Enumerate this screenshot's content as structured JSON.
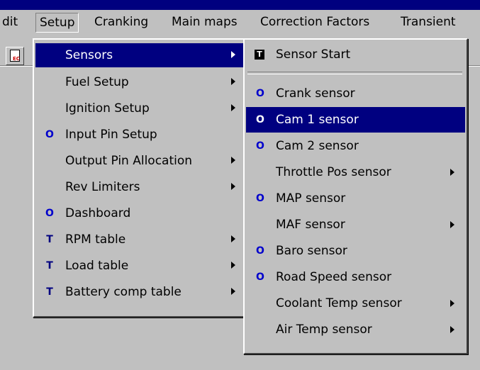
{
  "menubar": {
    "items": [
      {
        "label": "dit",
        "accel": ""
      },
      {
        "label": "Setup",
        "accel": "S"
      },
      {
        "label": "Cranking",
        "accel": "r"
      },
      {
        "label": "Main maps",
        "accel": "M"
      },
      {
        "label": "Correction Factors",
        "accel": "o"
      },
      {
        "label": "Transient",
        "accel": "a"
      }
    ]
  },
  "setup_menu": {
    "items": [
      {
        "label": "Sensors",
        "glyph": "",
        "submenu": true,
        "highlighted": true
      },
      {
        "label": "Fuel Setup",
        "glyph": "",
        "submenu": true
      },
      {
        "label": "Ignition Setup",
        "glyph": "",
        "submenu": true
      },
      {
        "label": "Input Pin Setup",
        "glyph": "O",
        "submenu": false
      },
      {
        "label": "Output Pin Allocation",
        "glyph": "",
        "submenu": true
      },
      {
        "label": "Rev Limiters",
        "glyph": "",
        "submenu": true
      },
      {
        "label": "Dashboard",
        "glyph": "O",
        "submenu": false
      },
      {
        "label": "RPM table",
        "glyph": "T",
        "submenu": true
      },
      {
        "label": "Load table",
        "glyph": "T",
        "submenu": true
      },
      {
        "label": "Battery comp table",
        "glyph": "T",
        "submenu": true
      }
    ]
  },
  "sensors_menu": {
    "start": {
      "label": "Sensor Start",
      "glyph": "T"
    },
    "items": [
      {
        "label": "Crank sensor",
        "glyph": "O",
        "submenu": false
      },
      {
        "label": "Cam 1 sensor",
        "glyph": "O",
        "submenu": false,
        "highlighted": true
      },
      {
        "label": "Cam 2 sensor",
        "glyph": "O",
        "submenu": false
      },
      {
        "label": "Throttle Pos sensor",
        "glyph": "",
        "submenu": true
      },
      {
        "label": "MAP sensor",
        "glyph": "O",
        "submenu": false
      },
      {
        "label": "MAF sensor",
        "glyph": "",
        "submenu": true
      },
      {
        "label": "Baro sensor",
        "glyph": "O",
        "submenu": false
      },
      {
        "label": "Road Speed sensor",
        "glyph": "O",
        "submenu": false
      },
      {
        "label": "Coolant Temp sensor",
        "glyph": "",
        "submenu": true
      },
      {
        "label": "Air Temp sensor",
        "glyph": "",
        "submenu": true
      }
    ]
  },
  "colors": {
    "menu_bg": "#c0c0c0",
    "highlight": "#000080",
    "glyph_blue": "#0000cc"
  }
}
